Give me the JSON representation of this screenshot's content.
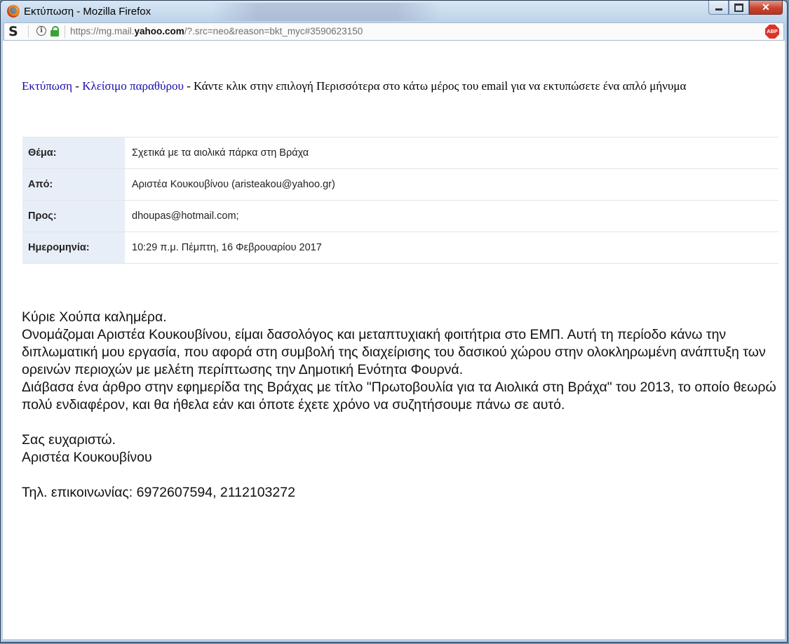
{
  "window": {
    "title": "Εκτύπωση - Mozilla Firefox",
    "url_prefix": "https://mg.mail.",
    "url_domain": "yahoo.com",
    "url_suffix": "/?.src=neo&reason=bkt_myc#3590623150",
    "adblock_label": "ABP"
  },
  "print_bar": {
    "print_link": "Εκτύπωση",
    "separator1": " - ",
    "close_link": "Κλείσιμο παραθύρου",
    "instruction": " - Κάντε κλικ στην επιλογή Περισσότερα στο κάτω μέρος του email για να εκτυπώσετε ένα απλό μήνυμα"
  },
  "headers": [
    {
      "label": "Θέμα:",
      "value": "Σχετικά με τα αιολικά πάρκα στη Βράχα"
    },
    {
      "label": "Από:",
      "value": "Αριστέα Κουκουβίνου (aristeakou@yahoo.gr)"
    },
    {
      "label": "Προς:",
      "value": "dhoupas@hotmail.com;"
    },
    {
      "label": "Ημερομηνία:",
      "value": "10:29 π.μ. Πέμπτη, 16 Φεβρουαρίου 2017"
    }
  ],
  "body": {
    "greeting": "Κύριε Χούπα καλημέρα.",
    "paragraph1": "Ονομάζομαι Αριστέα Κουκουβίνου, είμαι δασολόγος και μεταπτυχιακή φοιτήτρια στο ΕΜΠ. Αυτή τη περίοδο κάνω την διπλωματική μου εργασία, που αφορά στη συμβολή της διαχείρισης του δασικού χώρου στην ολοκληρωμένη ανάπτυξη των ορεινών περιοχών με μελέτη περίπτωσης την Δημοτική Ενότητα Φουρνά.",
    "paragraph2": "Διάβασα ένα άρθρο στην εφημερίδα της Βράχας με τίτλο \"Πρωτοβουλία για τα Αιολικά στη Βράχα\" του 2013, το οποίο θεωρώ πολύ ενδιαφέρον, και θα ήθελα εάν και όποτε έχετε χρόνο να συζητήσουμε πάνω σε αυτό.",
    "thanks": "Σας ευχαριστώ.",
    "signature": "Αριστέα Κουκουβίνου",
    "contact": "Τηλ. επικοινωνίας: 6972607594, 2112103272"
  }
}
